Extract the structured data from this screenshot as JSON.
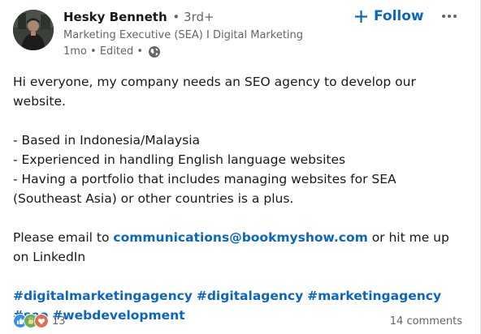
{
  "author": {
    "name": "Hesky Benneth",
    "degree": "• 3rd+",
    "headline": "Marketing Executive (SEA) I Digital Marketing",
    "meta": "1mo • Edited •",
    "visibility_icon": "globe-icon"
  },
  "actions": {
    "follow_label": "Follow",
    "follow_icon": "plus-icon",
    "more_icon": "ellipsis-icon"
  },
  "post": {
    "intro": "Hi everyone, my company needs an SEO agency to develop our website.",
    "requirements": [
      "- Based in Indonesia/Malaysia",
      "- Experienced in handling English language websites",
      "- Having a portfolio that includes managing websites for SEA (Southeast Asia) or other countries is a plus."
    ],
    "contact_prefix": "Please email to ",
    "contact_email": "communications@bookmyshow.com",
    "contact_suffix": " or hit me up on LinkedIn",
    "hashtags": [
      "#digitalmarketingagency",
      "#digitalagency",
      "#marketingagency",
      "#seo",
      "#webdevelopment"
    ]
  },
  "social": {
    "reaction_icons": [
      "like-icon",
      "celebrate-icon",
      "love-icon"
    ],
    "reaction_count": "13",
    "comments": "14 comments"
  },
  "colors": {
    "accent": "#0a66c2",
    "text": "#191919",
    "muted": "#666666"
  }
}
